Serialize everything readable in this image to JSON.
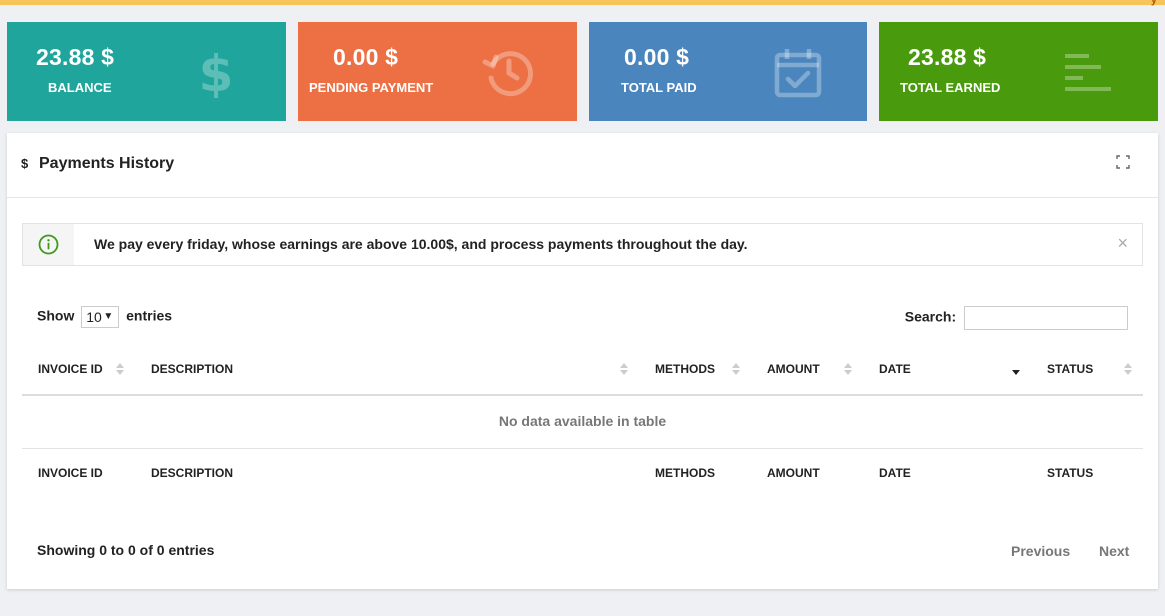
{
  "colors": {
    "balance": "#1fa59c",
    "pending": "#ed6f44",
    "paid": "#4a86bd",
    "earned": "#499b0d",
    "topbar": "#f7c35b"
  },
  "cards": [
    {
      "value": "23.88 $",
      "label": "BALANCE",
      "icon": "dollar-icon"
    },
    {
      "value": "0.00 $",
      "label": "PENDING PAYMENT",
      "icon": "history-icon"
    },
    {
      "value": "0.00 $",
      "label": "TOTAL PAID",
      "icon": "calendar-check-icon"
    },
    {
      "value": "23.88 $",
      "label": "TOTAL EARNED",
      "icon": "bars-icon"
    }
  ],
  "panel": {
    "icon": "$",
    "title": "Payments History"
  },
  "alert": {
    "message": "We pay every friday, whose earnings are above 10.00$, and process payments throughout the day."
  },
  "table_controls": {
    "show_label": "Show",
    "entries_value": "10",
    "entries_label": "entries",
    "search_label": "Search:",
    "search_value": ""
  },
  "table": {
    "columns": [
      "INVOICE ID",
      "DESCRIPTION",
      "METHODS",
      "AMOUNT",
      "DATE",
      "STATUS"
    ],
    "empty_message": "No data available in table"
  },
  "footer": {
    "info": "Showing 0 to 0 of 0 entries",
    "previous": "Previous",
    "next": "Next"
  }
}
